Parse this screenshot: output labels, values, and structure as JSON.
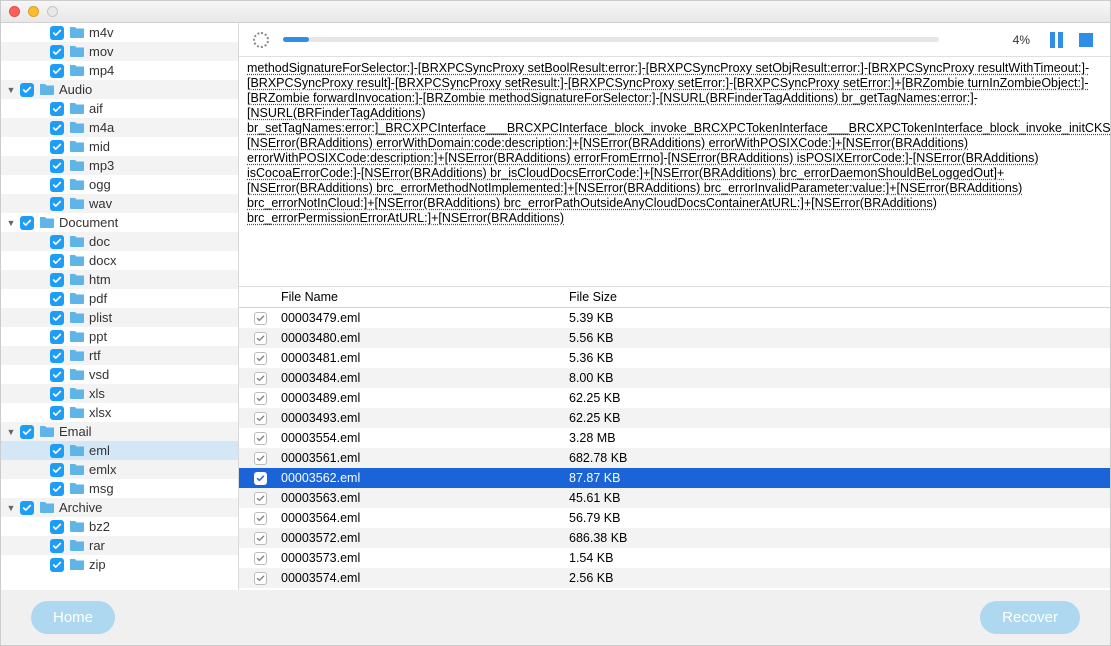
{
  "progress": {
    "percent_label": "4%",
    "percent": 4
  },
  "sidebar": {
    "items": [
      {
        "indent": 2,
        "label": "m4v",
        "expand": ""
      },
      {
        "indent": 2,
        "label": "mov",
        "expand": ""
      },
      {
        "indent": 2,
        "label": "mp4",
        "expand": ""
      },
      {
        "indent": 1,
        "label": "Audio",
        "expand": "▼"
      },
      {
        "indent": 2,
        "label": "aif",
        "expand": ""
      },
      {
        "indent": 2,
        "label": "m4a",
        "expand": ""
      },
      {
        "indent": 2,
        "label": "mid",
        "expand": ""
      },
      {
        "indent": 2,
        "label": "mp3",
        "expand": ""
      },
      {
        "indent": 2,
        "label": "ogg",
        "expand": ""
      },
      {
        "indent": 2,
        "label": "wav",
        "expand": ""
      },
      {
        "indent": 1,
        "label": "Document",
        "expand": "▼"
      },
      {
        "indent": 2,
        "label": "doc",
        "expand": ""
      },
      {
        "indent": 2,
        "label": "docx",
        "expand": ""
      },
      {
        "indent": 2,
        "label": "htm",
        "expand": ""
      },
      {
        "indent": 2,
        "label": "pdf",
        "expand": ""
      },
      {
        "indent": 2,
        "label": "plist",
        "expand": ""
      },
      {
        "indent": 2,
        "label": "ppt",
        "expand": ""
      },
      {
        "indent": 2,
        "label": "rtf",
        "expand": ""
      },
      {
        "indent": 2,
        "label": "vsd",
        "expand": ""
      },
      {
        "indent": 2,
        "label": "xls",
        "expand": ""
      },
      {
        "indent": 2,
        "label": "xlsx",
        "expand": ""
      },
      {
        "indent": 1,
        "label": "Email",
        "expand": "▼"
      },
      {
        "indent": 2,
        "label": "eml",
        "expand": ""
      },
      {
        "indent": 2,
        "label": "emlx",
        "expand": ""
      },
      {
        "indent": 2,
        "label": "msg",
        "expand": ""
      },
      {
        "indent": 1,
        "label": "Archive",
        "expand": "▼"
      },
      {
        "indent": 2,
        "label": "bz2",
        "expand": ""
      },
      {
        "indent": 2,
        "label": "rar",
        "expand": ""
      },
      {
        "indent": 2,
        "label": "zip",
        "expand": ""
      }
    ],
    "selected_index": 22
  },
  "dump_text": "methodSignatureForSelector:]-[BRXPCSyncProxy setBoolResult:error:]-[BRXPCSyncProxy setObjResult:error:]-[BRXPCSyncProxy resultWithTimeout:]-[BRXPCSyncProxy result]-[BRXPCSyncProxy setResult:]-[BRXPCSyncProxy setError:]-[BRXPCSyncProxy setError:]+[BRZombie turnInZombieObject:]-[BRZombie forwardInvocation:]-[BRZombie methodSignatureForSelector:]-[NSURL(BRFinderTagAdditions) br_getTagNames:error:]-[NSURL(BRFinderTagAdditions) br_setTagNames:error:]_BRCXPCInterface___BRCXPCInterface_block_invoke_BRCXPCTokenInterface___BRCXPCTokenInterface_block_invoke_initCKShareID_CKShareIDFunction_initCKRecordZoneID_CKRecordZoneIDFunction_BRCopyBundleIdentifierForURLInContainer_BRIsURLInCloudDocsContainer_BRCopyDisplayNameForContainerAtURL_BRCopyUbiquitousBookmarkDataForDocumentAtURL___BRCopyUbiquitousBookmarkDataForDocumentAtURL_block_invoke_BRCopyDocumentURLForUbiquitousBookmarkData___BRCopyDocumentURLForUbiquitousBookmarkData_block_invoke_BRIsURLExternalDocumentReference_BRCopyResolvedURLForExternalDocumentReferenceAtURL_BRCFGetAttributeValuesForItem___BRCFGetAttributeValuesForItem_block_invoke___copy_helper_block_89___destroy_helper_block_90_BRCopyRepresentedFileNameForFaultFileURL_BRIsURLInMobileDocuments_BRTrashExternalDocumentReference+[NSError(BRAdditions) errorWithDomain:code:description:]+[NSError(BRAdditions) errorWithPOSIXCode:]+[NSError(BRAdditions) errorWithPOSIXCode:description:]+[NSError(BRAdditions) errorFromErrno]-[NSError(BRAdditions) isPOSIXErrorCode:]-[NSError(BRAdditions) isCocoaErrorCode:]-[NSError(BRAdditions) br_isCloudDocsErrorCode:]+[NSError(BRAdditions) brc_errorDaemonShouldBeLoggedOut]+[NSError(BRAdditions) brc_errorMethodNotImplemented:]+[NSError(BRAdditions) brc_errorInvalidParameter:value:]+[NSError(BRAdditions) brc_errorNotInCloud:]+[NSError(BRAdditions) brc_errorPathOutsideAnyCloudDocsContainerAtURL:]+[NSError(BRAdditions) brc_errorPermissionErrorAtURL:]+[NSError(BRAdditions)",
  "table": {
    "headers": {
      "name": "File Name",
      "size": "File Size"
    },
    "rows": [
      {
        "name": "00003479.eml",
        "size": "5.39 KB"
      },
      {
        "name": "00003480.eml",
        "size": "5.56 KB"
      },
      {
        "name": "00003481.eml",
        "size": "5.36 KB"
      },
      {
        "name": "00003484.eml",
        "size": "8.00 KB"
      },
      {
        "name": "00003489.eml",
        "size": "62.25 KB"
      },
      {
        "name": "00003493.eml",
        "size": "62.25 KB"
      },
      {
        "name": "00003554.eml",
        "size": "3.28 MB"
      },
      {
        "name": "00003561.eml",
        "size": "682.78 KB"
      },
      {
        "name": "00003562.eml",
        "size": "87.87 KB"
      },
      {
        "name": "00003563.eml",
        "size": "45.61 KB"
      },
      {
        "name": "00003564.eml",
        "size": "56.79 KB"
      },
      {
        "name": "00003572.eml",
        "size": "686.38 KB"
      },
      {
        "name": "00003573.eml",
        "size": "1.54 KB"
      },
      {
        "name": "00003574.eml",
        "size": "2.56 KB"
      }
    ],
    "selected_index": 8
  },
  "footer": {
    "home": "Home",
    "recover": "Recover"
  }
}
